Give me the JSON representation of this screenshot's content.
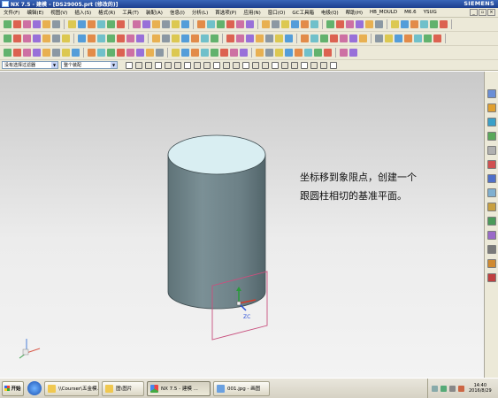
{
  "titlebar": {
    "title": "NX 7.5 - 建模 - [DS29005.prt (修改的)]",
    "brand": "SIEMENS"
  },
  "menu": [
    "文件(F)",
    "编辑(E)",
    "视图(V)",
    "插入(S)",
    "格式(R)",
    "工具(T)",
    "装配(A)",
    "信息(I)",
    "分析(L)",
    "首选项(P)",
    "应用(N)",
    "窗口(O)",
    "GC工具箱",
    "电极(Q)",
    "帮助(H)",
    "HB_MOULD",
    "M6.6",
    "YSUG"
  ],
  "window_controls": [
    "_",
    "▫",
    "×"
  ],
  "selection_bar": {
    "filter": "没有选择过滤器",
    "scope": "整个装配"
  },
  "annotation": {
    "line1": "坐标移到象限点，创建一个",
    "line2": "跟圆柱相切的基准平面。"
  },
  "triad": {
    "zc": "ZC"
  },
  "taskbar": {
    "start": "开始",
    "tasks": [
      "\\\\Courser\\五金模...",
      "图\\图片",
      "NX 7.5 - 建模 ...",
      "001.jpg - 画图"
    ],
    "time": "14:40",
    "date": "2016/8/29"
  },
  "colors": {
    "cylinder_top": "#d9eef2",
    "cylinder_side": "#6e8288",
    "plane_border": "#c8507e",
    "titlebar": "#1d3f8f"
  }
}
